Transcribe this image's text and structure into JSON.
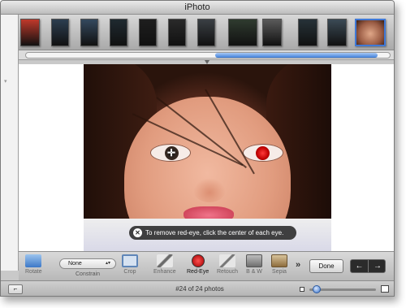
{
  "window": {
    "title": "iPhoto"
  },
  "filmstrip": {
    "thumbnails": [
      {
        "color": "#c0392b"
      },
      {
        "color": "#2c3e50"
      },
      {
        "color": "#34495e"
      },
      {
        "color": "#1f2a30"
      },
      {
        "color": "#1e1e1e"
      },
      {
        "color": "#2a2a2a"
      },
      {
        "color": "#3a3f44"
      },
      {
        "color": "#2f3b2f"
      },
      {
        "color": "#5a5a5a"
      },
      {
        "color": "#263238"
      },
      {
        "color": "#3b4a55"
      },
      {
        "color": "#c9906b",
        "selected": true
      }
    ],
    "scroll_position": 0.55
  },
  "tooltip": {
    "text": "To remove red-eye, click the center of each eye."
  },
  "toolbar": {
    "rotate": "Rotate",
    "constrain_value": "None",
    "constrain": "Constrain",
    "crop": "Crop",
    "enhance": "Enhance",
    "red_eye": "Red-Eye",
    "retouch": "Retouch",
    "bw": "B & W",
    "sepia": "Sepia",
    "more": "»",
    "done": "Done"
  },
  "status": {
    "text": "#24 of 24 photos",
    "zoom_level": 0.05
  },
  "icons": {
    "key": "key-icon",
    "prev": "←",
    "next": "→",
    "close": "✕",
    "crosshair": "✛"
  }
}
